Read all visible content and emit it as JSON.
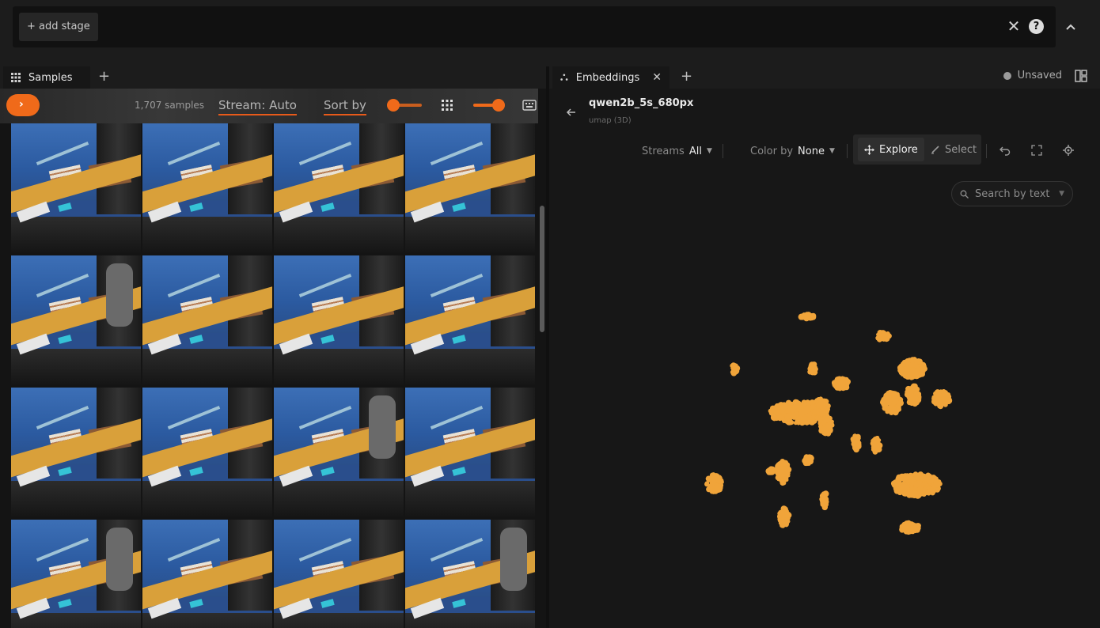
{
  "viewbar": {
    "add_stage_label": "+ add stage"
  },
  "left_panel": {
    "tab_label": "Samples"
  },
  "samples_toolbar": {
    "count": "1,707 samples",
    "stream_label": "Stream: Auto",
    "sort_label": "Sort by"
  },
  "right_panel": {
    "tab_label": "Embeddings",
    "save_status": "Unsaved"
  },
  "embeddings": {
    "title": "qwen2b_5s_680px",
    "subtitle": "umap (3D)",
    "streams": {
      "label": "Streams",
      "value": "All"
    },
    "color_by": {
      "label": "Color by",
      "value": "None"
    },
    "explore_label": "Explore",
    "select_label": "Select",
    "search_placeholder": "Search by text"
  },
  "colors": {
    "accent": "#f06a1a",
    "point_color": "#f0a43a",
    "background": "#171717"
  },
  "icons": [
    "grid-icon",
    "plus-icon",
    "close-icon",
    "help-icon",
    "chevron-up-icon",
    "layout-icon",
    "embeddings-icon",
    "arrow-left-icon",
    "move-icon",
    "pencil-icon",
    "undo-icon",
    "fullscreen-icon",
    "gear-icon",
    "search-icon",
    "chevron-right-icon",
    "keyboard-icon"
  ]
}
